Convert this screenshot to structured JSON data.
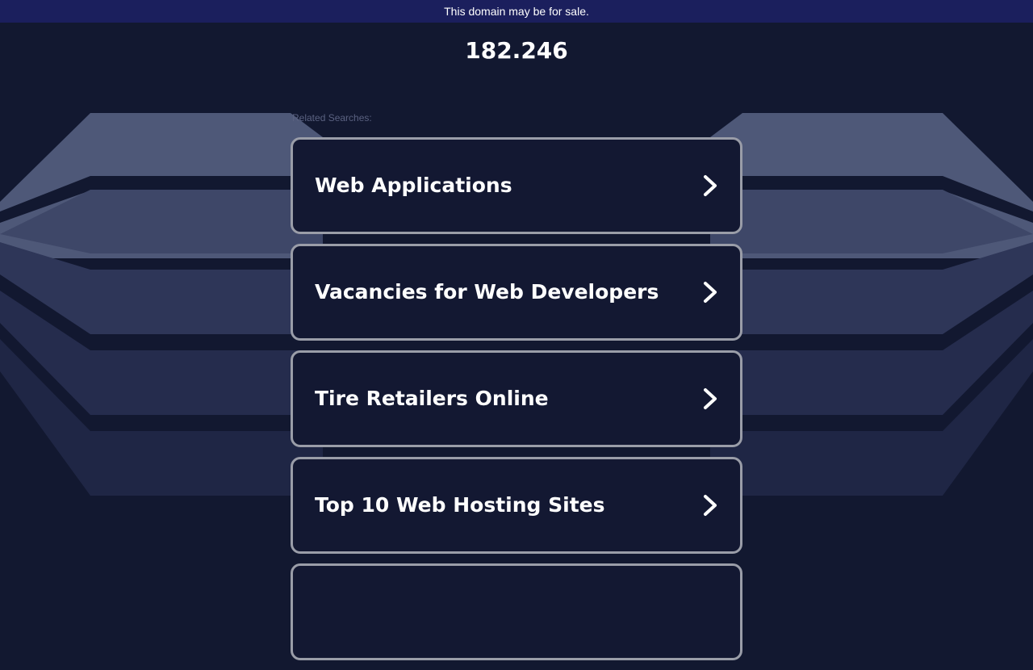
{
  "banner": {
    "text": "This domain may be for sale."
  },
  "domain": {
    "title": "182.246"
  },
  "related": {
    "label": "Related Searches:",
    "items": [
      {
        "label": "Web Applications",
        "icon": "chevron-right-icon"
      },
      {
        "label": "Vacancies for Web Developers",
        "icon": "chevron-right-icon"
      },
      {
        "label": "Tire Retailers Online",
        "icon": "chevron-right-icon"
      },
      {
        "label": "Top 10 Web Hosting Sites",
        "icon": "chevron-right-icon"
      },
      {
        "label": "",
        "icon": "chevron-right-icon"
      }
    ]
  },
  "colors": {
    "background": "#121830",
    "banner": "#1b1f5d",
    "card_border": "#9a9da8",
    "wing_light": "#4e5878"
  }
}
